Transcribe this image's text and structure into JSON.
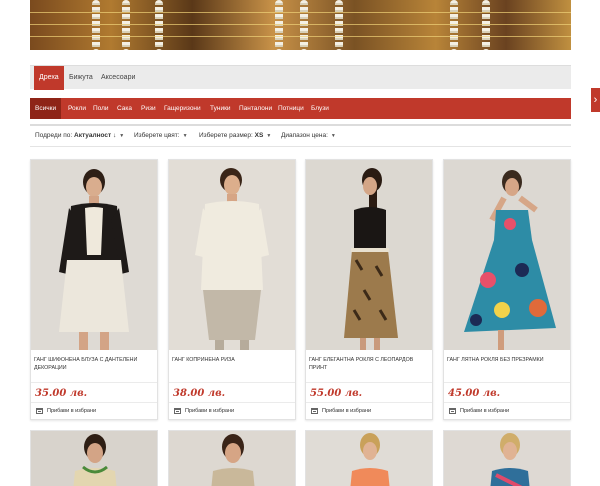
{
  "categories": {
    "items": [
      {
        "label": "Дреха",
        "active": true
      },
      {
        "label": "Бижута",
        "active": false
      },
      {
        "label": "Аксесоари",
        "active": false
      }
    ]
  },
  "subcategories": {
    "items": [
      {
        "label": "Всички",
        "active": true
      },
      {
        "label": "Рокли"
      },
      {
        "label": "Поли"
      },
      {
        "label": "Сака"
      },
      {
        "label": "Ризи"
      },
      {
        "label": "Гащеризони"
      },
      {
        "label": "Туники"
      },
      {
        "label": "Панталони"
      },
      {
        "label": "Потници"
      },
      {
        "label": "Блузи"
      }
    ]
  },
  "filters": {
    "sort_label": "Подреди по:",
    "sort_value": "Актуалност ↓",
    "color_label": "Изберете цвят:",
    "size_label": "Изберете размер:",
    "size_value": "XS",
    "price_label": "Диапазон цена:"
  },
  "products": [
    {
      "name": "Ганг шифонена блуза с дантелени декорации",
      "price": "35.00 лв.",
      "fav_label": "Прибави в избрани"
    },
    {
      "name": "Ганг копринена риза",
      "price": "38.00 лв.",
      "fav_label": "Прибави в избрани"
    },
    {
      "name": "Ганг елегантна рокля с леопардов принт",
      "price": "55.00 лв.",
      "fav_label": "Прибави в избрани"
    },
    {
      "name": "Ганг лятна рокля без презрамки",
      "price": "45.00 лв.",
      "fav_label": "Прибави в избрани"
    }
  ],
  "colors": {
    "accent": "#c0392b",
    "accent_dark": "#8e2417",
    "price": "#c0392b"
  }
}
